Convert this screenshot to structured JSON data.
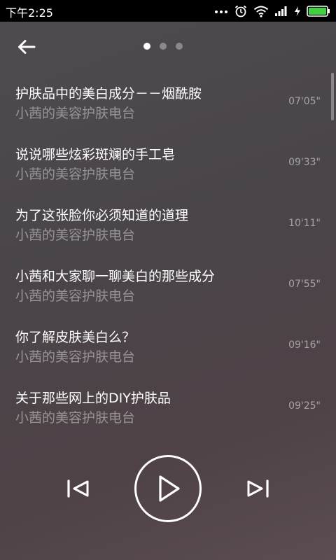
{
  "status_bar": {
    "time": "下午2:25",
    "icons": [
      "more-dots-icon",
      "alarm-icon",
      "wifi-icon",
      "signal-icon",
      "charging-icon",
      "battery-icon"
    ],
    "battery_color": "#3fd13f"
  },
  "header": {
    "back_icon": "back-arrow-icon",
    "page_indicator": {
      "count": 3,
      "active_index": 0
    }
  },
  "playlist": {
    "items": [
      {
        "title": "护肤品中的美白成分－－烟酰胺",
        "subtitle": "小茜的美容护肤电台",
        "duration": "07'05\""
      },
      {
        "title": "说说哪些炫彩斑斓的手工皂",
        "subtitle": "小茜的美容护肤电台",
        "duration": "09'33\""
      },
      {
        "title": "为了这张脸你必须知道的道理",
        "subtitle": "小茜的美容护肤电台",
        "duration": "10'11\""
      },
      {
        "title": "小茜和大家聊一聊美白的那些成分",
        "subtitle": "小茜的美容护肤电台",
        "duration": "07'55\""
      },
      {
        "title": "你了解皮肤美白么？",
        "subtitle": "小茜的美容护肤电台",
        "duration": "09'16\""
      },
      {
        "title": "关于那些网上的DIY护肤品",
        "subtitle": "小茜的美容护肤电台",
        "duration": "09'25\""
      }
    ]
  },
  "player_controls": {
    "prev_icon": "skip-previous-icon",
    "play_icon": "play-icon",
    "next_icon": "skip-next-icon"
  },
  "colors": {
    "background": "#4b464c",
    "text_primary": "#ffffff",
    "text_secondary": "#8f8a8e",
    "battery": "#3fd13f"
  }
}
